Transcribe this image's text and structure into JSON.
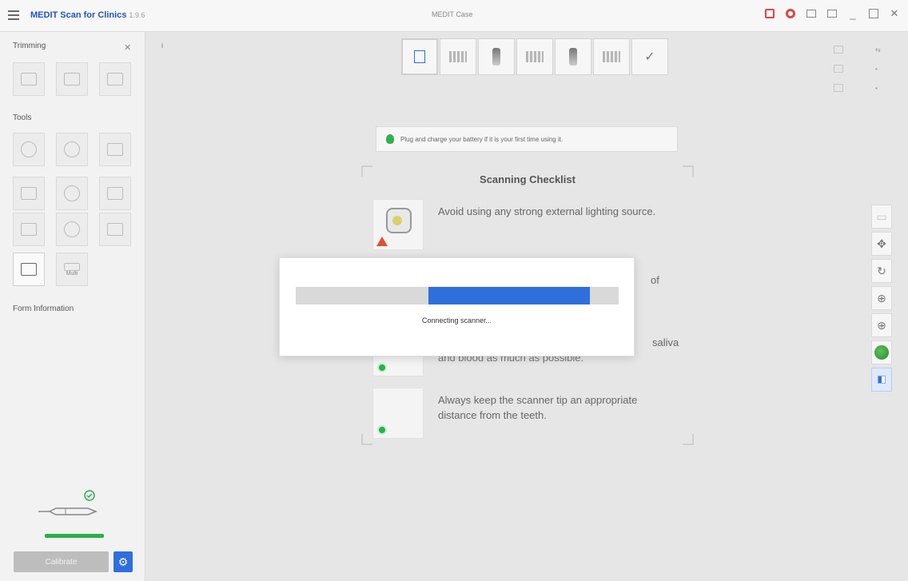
{
  "window": {
    "app_title": "MEDIT Scan for Clinics",
    "version": "1.9.6",
    "caption": "MEDIT Case"
  },
  "sidebar": {
    "trimming_label": "Trimming",
    "tools_label": "Tools",
    "form_info_label": "Form Information",
    "calibrate_label": "Calibrate",
    "tool_tile_label": "Multi",
    "scanner_connected": true
  },
  "stages": [
    "edit-icon",
    "maxilla-scan-icon",
    "upper-die-icon",
    "mandible-scan-icon",
    "lower-die-icon",
    "occlusion-scan-icon",
    "checkmark-icon"
  ],
  "tip": {
    "text": "Plug and charge your battery if it is your first time using it."
  },
  "checklist": {
    "title": "Scanning Checklist",
    "items": [
      {
        "text": "Avoid using any strong external lighting source.",
        "status": "warning"
      },
      {
        "text": "",
        "status": "ok"
      },
      {
        "text": "",
        "status": "ok"
      },
      {
        "text": "Always keep the scanner tip an appropriate distance from the teeth.",
        "status": "ok"
      }
    ],
    "item2_fragment": "of",
    "item3_fragment": "saliva",
    "item3_line2": "and blood as much as possible."
  },
  "modal": {
    "message": "Connecting scanner...",
    "progress": 0.5
  },
  "colors": {
    "brand": "#1e55c8",
    "accent": "#2f6fdc",
    "success": "#27b04b",
    "danger": "#e04545"
  }
}
